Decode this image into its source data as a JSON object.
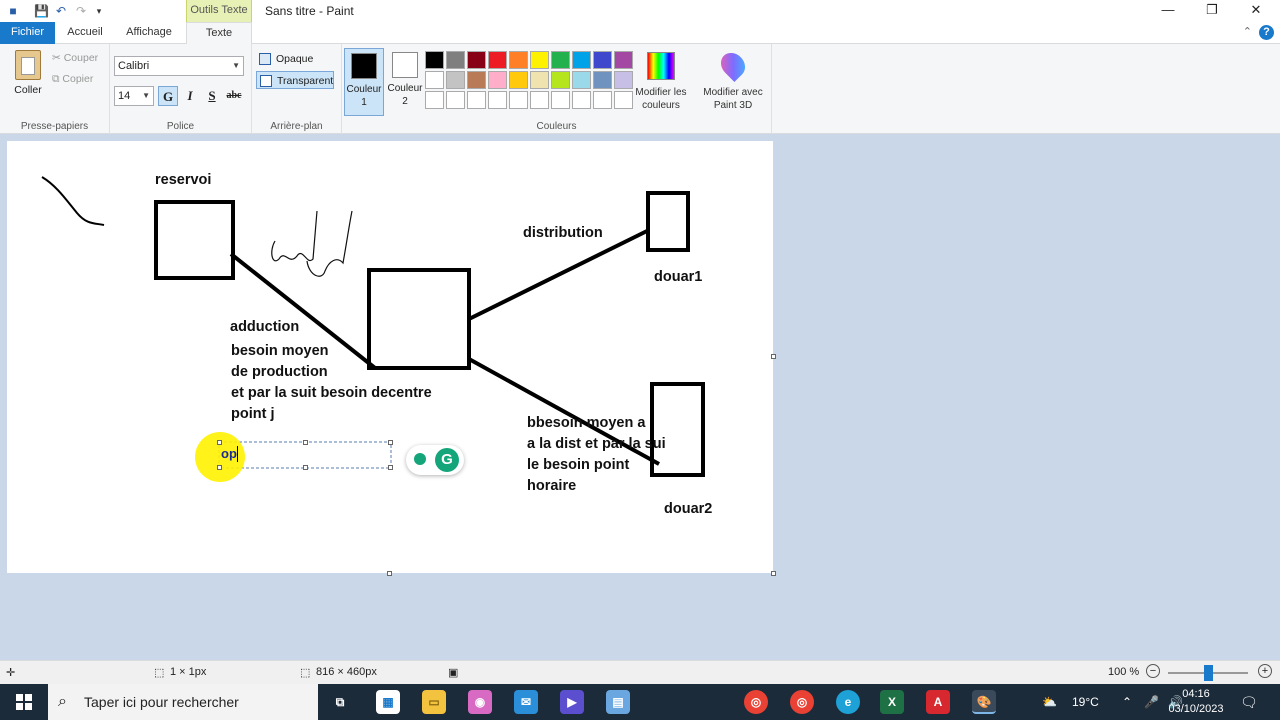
{
  "window": {
    "title": "Sans titre - Paint",
    "context_tab": "Outils Texte",
    "controls": [
      "—",
      "❐",
      "✕"
    ]
  },
  "tabs": [
    {
      "label": "Fichier"
    },
    {
      "label": "Accueil"
    },
    {
      "label": "Affichage"
    },
    {
      "label": "Texte"
    }
  ],
  "ribbon": {
    "clipboard": {
      "paste": "Coller",
      "cut": "Couper",
      "copy": "Copier",
      "group": "Presse-papiers"
    },
    "font": {
      "family": "Calibri",
      "size": "14",
      "bold": "G",
      "italic": "I",
      "underline": "S",
      "strike": "abc",
      "group": "Police"
    },
    "background": {
      "opaque": "Opaque",
      "transparent": "Transparent",
      "group": "Arrière-plan"
    },
    "colors": {
      "color1": "Couleur\n1",
      "color2": "Couleur\n2",
      "edit": "Modifier les\ncouleurs",
      "paint3d": "Modifier avec\nPaint 3D",
      "group": "Couleurs",
      "palette": [
        "#000000",
        "#7f7f7f",
        "#880015",
        "#ed1c24",
        "#ff7f27",
        "#fff200",
        "#22b14c",
        "#00a2e8",
        "#3f48cc",
        "#a349a4",
        "#ffffff",
        "#c3c3c3",
        "#b97a57",
        "#ffaec9",
        "#ffc90e",
        "#efe4b0",
        "#b5e61d",
        "#99d9ea",
        "#7092be",
        "#c8bfe7",
        "#ffffff",
        "#ffffff",
        "#ffffff",
        "#ffffff",
        "#ffffff",
        "#ffffff",
        "#ffffff",
        "#ffffff",
        "#ffffff",
        "#ffffff"
      ]
    }
  },
  "canvas": {
    "labels": {
      "reservoir": "reservoi",
      "distribution": "distribution",
      "douar1": "douar1",
      "adduction": "adduction",
      "adduction_note": "besoin moyen\nde production\net par la suit besoin decentre\npoint j",
      "distribution_note": "bbesoin moyen a\na la dist et par la sui\nle besoin point\nhoraire",
      "douar2": "douar2",
      "editing_text": "op"
    }
  },
  "status": {
    "selection": "1 × 1px",
    "canvas_size": "816 × 460px",
    "zoom": "100 %"
  },
  "taskbar": {
    "search_placeholder": "Taper ici pour rechercher",
    "temperature": "19°C",
    "time": "04:16",
    "date": "03/10/2023"
  }
}
